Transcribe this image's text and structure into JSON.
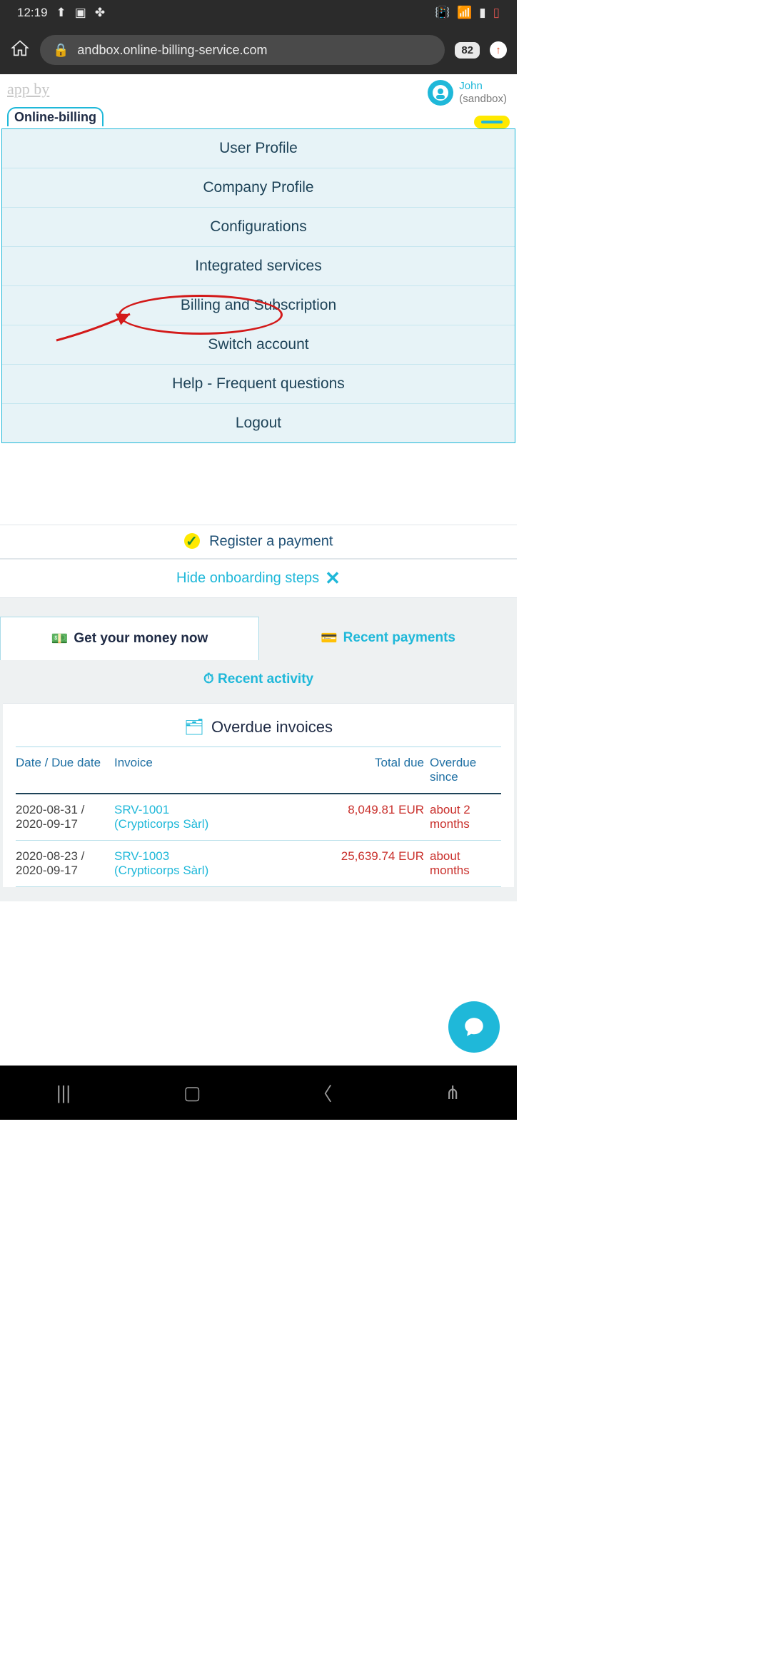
{
  "status": {
    "time": "12:19",
    "tabs_count": "82"
  },
  "browser": {
    "url_display": "andbox.online-billing-service.com"
  },
  "header": {
    "app_by": "app by",
    "logo_text": "Online-billing",
    "user_name": "John",
    "user_env": "(sandbox)"
  },
  "dropdown": {
    "items": [
      "User Profile",
      "Company Profile",
      "Configurations",
      "Integrated services",
      "Billing and Subscription",
      "Switch account",
      "Help - Frequent questions",
      "Logout"
    ]
  },
  "options": {
    "register_payment": "Register a payment",
    "hide_onboarding": "Hide onboarding steps"
  },
  "tabs": {
    "money_now": "Get your money now",
    "recent_payments": "Recent payments",
    "recent_activity": "Recent activity"
  },
  "panel": {
    "title": "Overdue invoices",
    "columns": {
      "date": "Date / Due date",
      "invoice": "Invoice",
      "total": "Total due",
      "overdue": "Overdue since"
    },
    "rows": [
      {
        "date1": "2020-08-31 /",
        "date2": "2020-09-17",
        "inv_no": "SRV-1001",
        "inv_client": "(Crypticorps Sàrl)",
        "total": "8,049.81 EUR",
        "overdue1": "about 2",
        "overdue2": "months"
      },
      {
        "date1": "2020-08-23 /",
        "date2": "2020-09-17",
        "inv_no": "SRV-1003",
        "inv_client": "(Crypticorps Sàrl)",
        "total": "25,639.74 EUR",
        "overdue1": "about",
        "overdue2": "months"
      }
    ]
  }
}
